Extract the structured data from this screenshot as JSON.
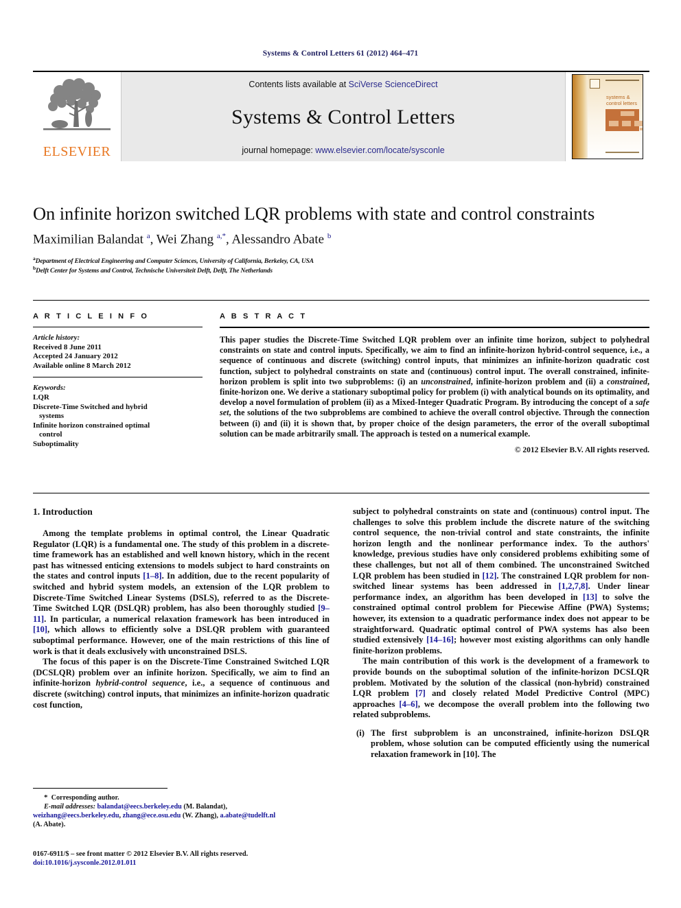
{
  "running_head": "Systems & Control Letters 61 (2012) 464–471",
  "banner": {
    "publisher_name": "ELSEVIER",
    "contents_prefix": "Contents lists available at ",
    "contents_link": "SciVerse ScienceDirect",
    "journal_name": "Systems & Control Letters",
    "homepage_prefix": "journal homepage: ",
    "homepage_link": "www.elsevier.com/locate/sysconle",
    "cover_title_line1": "systems &",
    "cover_title_line2": "control letters"
  },
  "article": {
    "title": "On infinite horizon switched LQR problems with state and control constraints",
    "authors_html": "Maximilian Balandat <sup>a</sup>, Wei Zhang <sup>a,*</sup>, Alessandro Abate <sup>b</sup>",
    "affiliation_a_marker": "a",
    "affiliation_a": "Department of Electrical Engineering and Computer Sciences, University of California, Berkeley, CA, USA",
    "affiliation_b_marker": "b",
    "affiliation_b": "Delft Center for Systems and Control, Technische Universiteit Delft, Delft, The Netherlands"
  },
  "info": {
    "heading": "A R T I C L E   I N F O",
    "history_label": "Article history:",
    "history": [
      "Received 8 June 2011",
      "Accepted 24 January 2012",
      "Available online 8 March 2012"
    ],
    "keywords_label": "Keywords:",
    "keywords": [
      "LQR",
      "Discrete-Time Switched and hybrid",
      "systems",
      "Infinite horizon constrained optimal",
      "control",
      "Suboptimality"
    ]
  },
  "abstract": {
    "heading": "A B S T R A C T",
    "text_pre_italic1": "This paper studies the Discrete-Time Switched LQR problem over an infinite time horizon, subject to polyhedral constraints on state and control inputs. Specifically, we aim to find an infinite-horizon hybrid-control sequence, i.e., a sequence of continuous and discrete (switching) control inputs, that minimizes an infinite-horizon quadratic cost function, subject to polyhedral constraints on state and (continuous) control input. The overall constrained, infinite-horizon problem is split into two subproblems: (i) an ",
    "italic1": "unconstrained",
    "text_mid1": ", infinite-horizon problem and (ii) a ",
    "italic2": "constrained",
    "text_mid2": ", finite-horizon one. We derive a stationary suboptimal policy for problem (i) with analytical bounds on its optimality, and develop a novel formulation of problem (ii) as a Mixed-Integer Quadratic Program. By introducing the concept of a ",
    "italic3": "safe set",
    "text_end": ", the solutions of the two subproblems are combined to achieve the overall control objective. Through the connection between (i) and (ii) it is shown that, by proper choice of the design parameters, the error of the overall suboptimal solution can be made arbitrarily small. The approach is tested on a numerical example.",
    "copyright": "© 2012 Elsevier B.V. All rights reserved."
  },
  "body": {
    "section_number_title": "1. Introduction",
    "left": {
      "p1_a": "Among the template problems in optimal control, the Linear Quadratic Regulator (LQR) is a fundamental one. The study of this problem in a discrete-time framework has an established and well known history, which in the recent past has witnessed enticing extensions to models subject to hard constraints on the states and control inputs ",
      "p1_ref1": "[1–8]",
      "p1_b": ". In addition, due to the recent popularity of switched and hybrid system models, an extension of the LQR problem to Discrete-Time Switched Linear Systems (DSLS), referred to as the Discrete-Time Switched LQR (DSLQR) problem, has also been thoroughly studied ",
      "p1_ref2": "[9–11]",
      "p1_c": ". In particular, a numerical relaxation framework has been introduced in ",
      "p1_ref3": "[10]",
      "p1_d": ", which allows to efficiently solve a DSLQR problem with guaranteed suboptimal performance. However, one of the main restrictions of this line of work is that it deals exclusively with unconstrained DSLS.",
      "p2_a": "The focus of this paper is on the Discrete-Time Constrained Switched LQR (DCSLQR) problem over an infinite horizon. Specifically, we aim to find an infinite-horizon ",
      "p2_italic": "hybrid-control sequence",
      "p2_b": ", i.e., a sequence of continuous and discrete (switching) control inputs, that minimizes an infinite-horizon quadratic cost function,"
    },
    "right": {
      "p3_a": "subject to polyhedral constraints on state and (continuous) control input. The challenges to solve this problem include the discrete nature of the switching control sequence, the non-trivial control and state constraints, the infinite horizon length and the nonlinear performance index. To the authors' knowledge, previous studies have only considered problems exhibiting some of these challenges, but not all of them combined. The unconstrained Switched LQR problem has been studied in ",
      "p3_ref1": "[12]",
      "p3_b": ". The constrained LQR problem for non-switched linear systems has been addressed in ",
      "p3_ref2": "[1,2,7,8]",
      "p3_c": ". Under linear performance index, an algorithm has been developed in ",
      "p3_ref3": "[13]",
      "p3_d": " to solve the constrained optimal control problem for Piecewise Affine (PWA) Systems; however, its extension to a quadratic performance index does not appear to be straightforward. Quadratic optimal control of PWA systems has also been studied extensively ",
      "p3_ref4": "[14–16]",
      "p3_e": "; however most existing algorithms can only handle finite-horizon problems.",
      "p4_a": "The main contribution of this work is the development of a framework to provide bounds on the suboptimal solution of the infinite-horizon DCSLQR problem. Motivated by the solution of the classical (non-hybrid) constrained LQR problem ",
      "p4_ref1": "[7]",
      "p4_b": " and closely related Model Predictive Control (MPC) approaches ",
      "p4_ref2": "[4–6]",
      "p4_c": ", we decompose the overall problem into the following two related subproblems.",
      "item_i_marker": "(i)",
      "item_i_a": "The first subproblem is an unconstrained, infinite-horizon DSLQR problem, whose solution can be computed efficiently using the numerical relaxation framework in ",
      "item_i_ref": "[10]",
      "item_i_b": ". The"
    }
  },
  "footnotes": {
    "star": "*",
    "corresponding": "Corresponding author.",
    "email_label": "E-mail addresses:",
    "email1": "balandat@eecs.berkeley.edu",
    "email1_owner": " (M. Balandat),",
    "email2": "weizhang@eecs.berkeley.edu",
    "email_sep": ", ",
    "email3": "zhang@ece.osu.edu",
    "email3_owner": " (W. Zhang), ",
    "email4": "a.abate@tudelft.nl",
    "email4_owner": "(A. Abate).",
    "issn_line": "0167-6911/$ – see front matter © 2012 Elsevier B.V. All rights reserved.",
    "doi_line": "doi:10.1016/j.sysconle.2012.01.011"
  },
  "colors": {
    "link_blue": "#2a2a8c",
    "ref_blue": "#17179a",
    "elsevier_orange": "#e87722",
    "banner_gray": "#e9e9e9"
  }
}
